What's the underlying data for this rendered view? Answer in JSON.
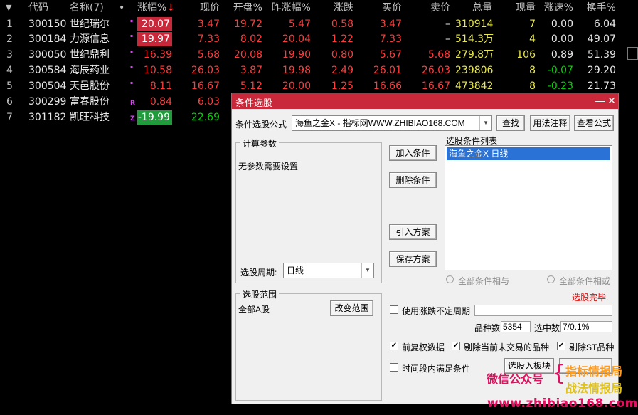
{
  "table": {
    "headers": {
      "sort_marker": "▼",
      "code": "代码",
      "name": "名称(7)",
      "dot": "•",
      "change_pct": "涨幅%",
      "sort_arrow": "↓",
      "price": "现价",
      "open_pct": "开盘%",
      "prev_change_pct": "昨涨幅%",
      "change": "涨跌",
      "bid": "买价",
      "ask": "卖价",
      "volume": "总量",
      "last_vol": "现量",
      "speed": "涨速%",
      "turnover": "换手%"
    },
    "rows": [
      {
        "idx": "1",
        "code": "300150",
        "name": "世纪瑞尔",
        "flag": "",
        "change_pct": "20.07",
        "price": "3.47",
        "open_pct": "19.72",
        "prev_change_pct": "5.47",
        "change": "0.58",
        "bid": "3.47",
        "ask": "–",
        "volume": "310914",
        "last_vol": "7",
        "speed": "0.00",
        "turnover": "6.04"
      },
      {
        "idx": "2",
        "code": "300184",
        "name": "力源信息",
        "flag": "",
        "change_pct": "19.97",
        "price": "7.33",
        "open_pct": "8.02",
        "prev_change_pct": "20.04",
        "change": "1.22",
        "bid": "7.33",
        "ask": "–",
        "volume": "514.3万",
        "last_vol": "4",
        "speed": "0.00",
        "turnover": "49.07"
      },
      {
        "idx": "3",
        "code": "300050",
        "name": "世纪鼎利",
        "flag": "",
        "change_pct": "16.39",
        "price": "5.68",
        "open_pct": "20.08",
        "prev_change_pct": "19.90",
        "change": "0.80",
        "bid": "5.67",
        "ask": "5.68",
        "volume": "279.8万",
        "last_vol": "106",
        "speed": "0.89",
        "turnover": "51.39"
      },
      {
        "idx": "4",
        "code": "300584",
        "name": "海辰药业",
        "flag": "",
        "change_pct": "10.58",
        "price": "26.03",
        "open_pct": "3.87",
        "prev_change_pct": "19.98",
        "change": "2.49",
        "bid": "26.01",
        "ask": "26.03",
        "volume": "239806",
        "last_vol": "8",
        "speed": "-0.07",
        "turnover": "29.20"
      },
      {
        "idx": "5",
        "code": "300504",
        "name": "天邑股份",
        "flag": "",
        "change_pct": "8.11",
        "price": "16.67",
        "open_pct": "5.12",
        "prev_change_pct": "20.00",
        "change": "1.25",
        "bid": "16.66",
        "ask": "16.67",
        "volume": "473842",
        "last_vol": "8",
        "speed": "-0.23",
        "turnover": "21.73"
      },
      {
        "idx": "6",
        "code": "300299",
        "name": "富春股份",
        "flag": "R",
        "change_pct": "0.84",
        "price": "6.03"
      },
      {
        "idx": "7",
        "code": "301182",
        "name": "凯旺科技",
        "flag": "Z",
        "change_pct": "-19.99",
        "price": "22.69"
      }
    ]
  },
  "dialog": {
    "title": "条件选股",
    "minimize": "—",
    "close": "✕",
    "formula_label": "条件选股公式",
    "formula_value": "海鱼之金X    - 指标网WWW.ZHIBIAO168.COM",
    "find_button": "查找",
    "usage_button": "用法注释",
    "view_formula_button": "查看公式",
    "params_group": "计算参数",
    "no_params_text": "无参数需要设置",
    "period_label": "选股周期:",
    "period_value": "日线",
    "add_condition": "加入条件",
    "delete_condition": "删除条件",
    "import_plan": "引入方案",
    "save_plan": "保存方案",
    "list_title": "选股条件列表",
    "list_items": [
      "海鱼之金X  日线"
    ],
    "radio_and": "全部条件相与",
    "radio_or": "全部条件相或",
    "status": "选股完毕.",
    "range_group": "选股范围",
    "range_value": "全部A股",
    "change_range_button": "改变范围",
    "use_uncertain_period": "使用涨跌不定周期",
    "count_label": "品种数",
    "count_value": "5354",
    "selected_label": "选中数",
    "selected_value": "7/0.1%",
    "pre_adjust": "前复权数据",
    "exclude_untraded": "剔除当前未交易的品种",
    "exclude_st": "剔除ST品种",
    "time_range": "时间段内满足条件",
    "to_block_button": "选股入板块",
    "check_mark": "✔"
  },
  "watermark": {
    "wechat": "微信公众号",
    "brace": "{",
    "line1": "指标情报局",
    "line2": "战法情报局",
    "url": "www.zhibiao168.com"
  },
  "colors": {
    "up": "#ff3c3c",
    "down": "#00d400",
    "volume": "#e8e84a",
    "titlebar": "#c8283a",
    "list_selection": "#2a72d6"
  }
}
